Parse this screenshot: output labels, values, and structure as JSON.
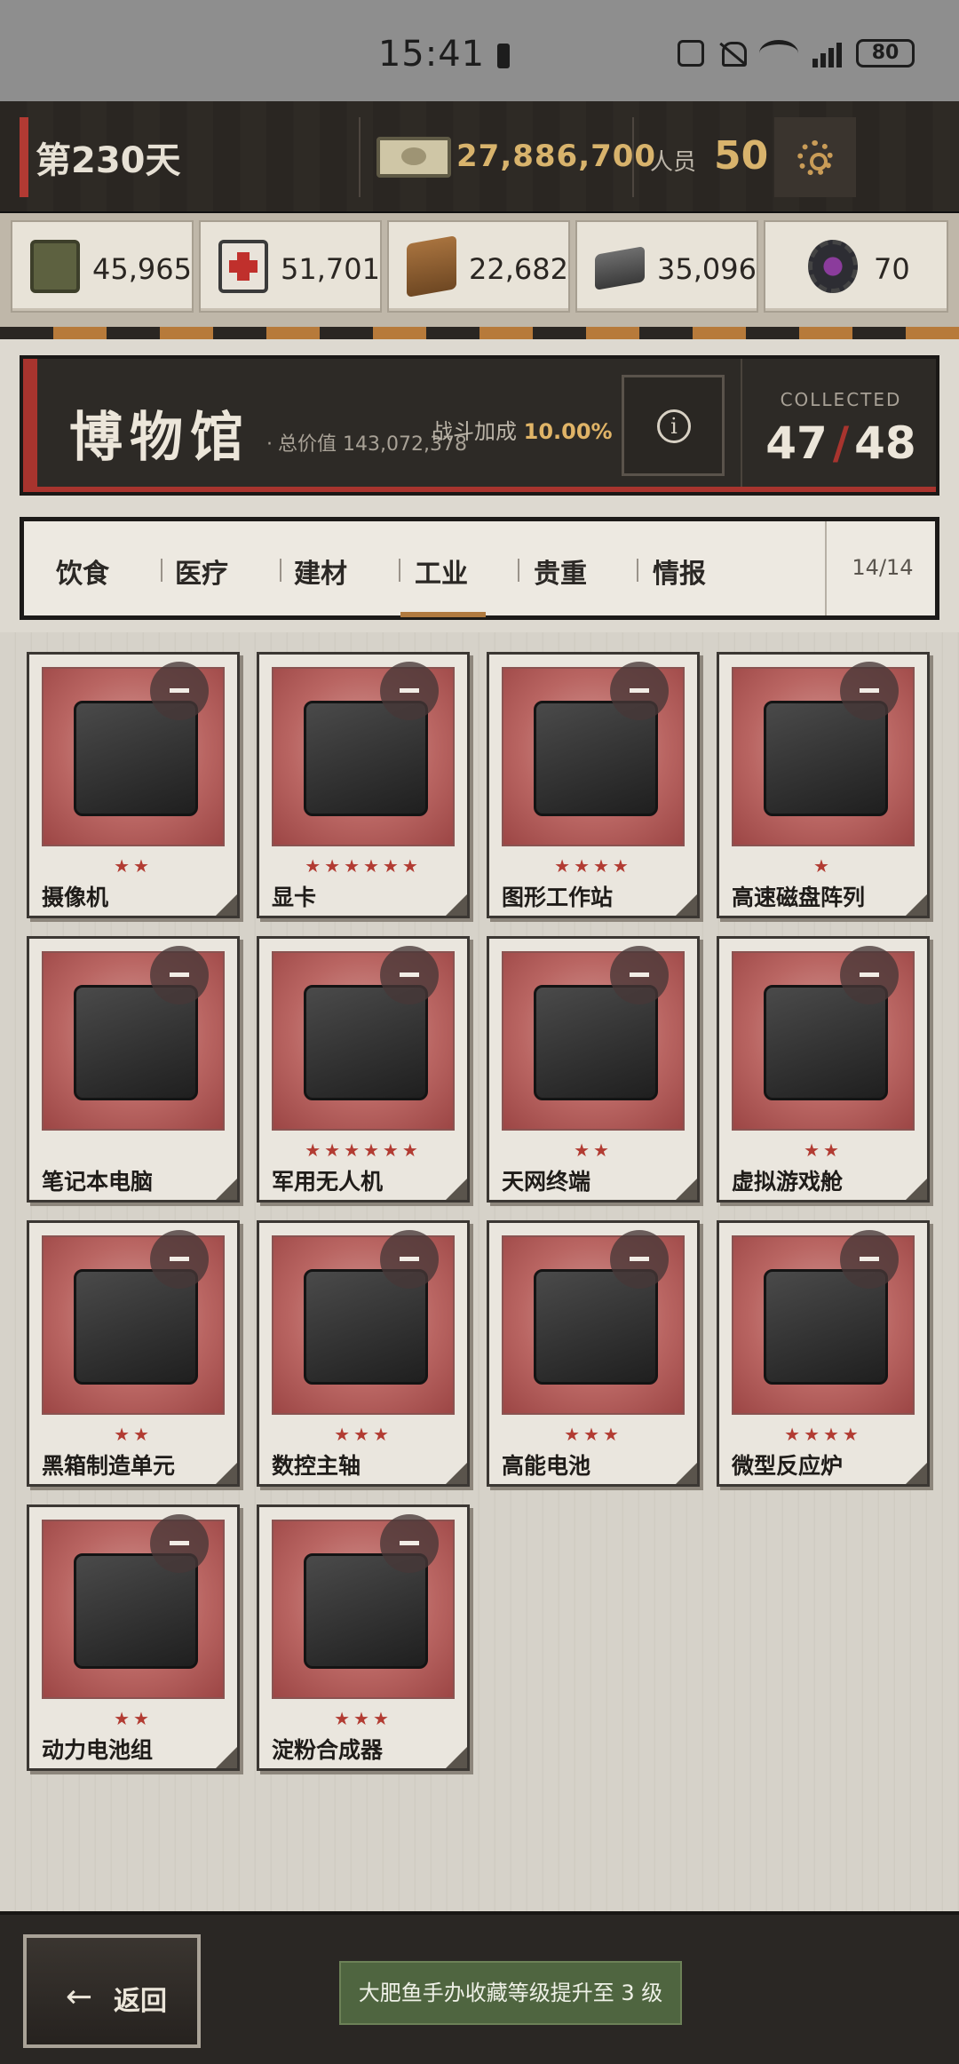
{
  "status_bar": {
    "time": "15:41",
    "battery": "80"
  },
  "topbar": {
    "day": "第230天",
    "money": "27,886,700",
    "population_label": "人员",
    "population": "50"
  },
  "resources": [
    {
      "icon": "grain-can-icon",
      "value": "45,965"
    },
    {
      "icon": "medkit-icon",
      "value": "51,701"
    },
    {
      "icon": "wood-planks-icon",
      "value": "22,682"
    },
    {
      "icon": "metal-ingot-icon",
      "value": "35,096"
    },
    {
      "icon": "gear-chip-icon",
      "value": "70"
    }
  ],
  "museum": {
    "title": "博物馆",
    "total_value_label": "总价值",
    "total_value": "143,072,378",
    "battle_bonus_label": "战斗加成",
    "battle_bonus": "10.00%",
    "collected_label": "COLLECTED",
    "collected": "47",
    "total": "48"
  },
  "tabs": {
    "items": [
      "饮食",
      "医疗",
      "建材",
      "工业",
      "贵重",
      "情报"
    ],
    "active": "工业",
    "count": "14/14"
  },
  "items": [
    {
      "name": "摄像机",
      "stars": "★★",
      "star_count": 2
    },
    {
      "name": "显卡",
      "stars": "★★★★★★",
      "star_count": 6
    },
    {
      "name": "图形工作站",
      "stars": "★★★★",
      "star_count": 4
    },
    {
      "name": "高速磁盘阵列",
      "stars": "★",
      "star_count": 1
    },
    {
      "name": "笔记本电脑",
      "stars": "",
      "star_count": 0
    },
    {
      "name": "军用无人机",
      "stars": "★★★★★★",
      "star_count": 6
    },
    {
      "name": "天网终端",
      "stars": "★★",
      "star_count": 2
    },
    {
      "name": "虚拟游戏舱",
      "stars": "★★",
      "star_count": 2
    },
    {
      "name": "黑箱制造单元",
      "stars": "★★",
      "star_count": 2
    },
    {
      "name": "数控主轴",
      "stars": "★★★",
      "star_count": 3
    },
    {
      "name": "高能电池",
      "stars": "★★★",
      "star_count": 3
    },
    {
      "name": "微型反应炉",
      "stars": "★★★★",
      "star_count": 4
    },
    {
      "name": "动力电池组",
      "stars": "★★",
      "star_count": 2
    },
    {
      "name": "淀粉合成器",
      "stars": "★★★",
      "star_count": 3
    }
  ],
  "bottom": {
    "back_label": "返回",
    "toast": "大肥鱼手办收藏等级提升至 3 级"
  },
  "colors": {
    "accent_red": "#a8342e",
    "gold": "#d8b36c",
    "tab_underline": "#b07a3f",
    "toast_green": "#4f6540"
  }
}
